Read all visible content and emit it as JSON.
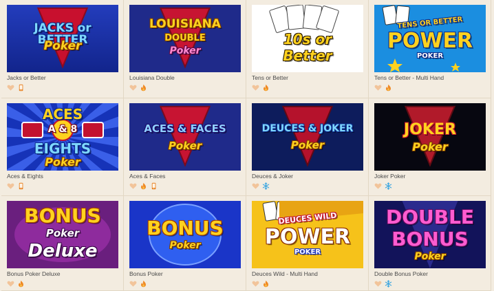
{
  "games": [
    {
      "title": "Jacks or Better",
      "logo_lines": [
        "JACKS or BETTER",
        "Poker"
      ],
      "theme": "blue-v",
      "icons": [
        "heart-icon",
        "mobile-icon"
      ]
    },
    {
      "title": "Louisiana Double",
      "logo_lines": [
        "LOUISIANA",
        "DOUBLE",
        "Poker"
      ],
      "theme": "navy-v",
      "icons": [
        "heart-icon",
        "fire-icon"
      ]
    },
    {
      "title": "Tens or Better",
      "logo_lines": [
        "10s or",
        "Better"
      ],
      "theme": "white-cards",
      "icons": [
        "heart-icon",
        "fire-icon"
      ]
    },
    {
      "title": "Tens or Better - Multi Hand",
      "logo_lines": [
        "TENS OR BETTER",
        "POWER",
        "POKER"
      ],
      "theme": "power-blue",
      "icons": [
        "heart-icon",
        "fire-icon"
      ]
    },
    {
      "title": "Aces & Eights",
      "logo_lines": [
        "ACES",
        "A & 8",
        "EIGHTS",
        "Poker"
      ],
      "theme": "rays-blue",
      "icons": [
        "heart-icon",
        "mobile-icon"
      ]
    },
    {
      "title": "Aces & Faces",
      "logo_lines": [
        "ACES & FACES",
        "Poker"
      ],
      "theme": "navy-v",
      "icons": [
        "heart-icon",
        "fire-icon",
        "mobile-icon"
      ]
    },
    {
      "title": "Deuces & Joker",
      "logo_lines": [
        "DEUCES & JOKER",
        "Poker"
      ],
      "theme": "dark-blue-v",
      "icons": [
        "heart-icon",
        "snowflake-icon"
      ]
    },
    {
      "title": "Joker Poker",
      "logo_lines": [
        "JOKER",
        "Poker"
      ],
      "theme": "black-v",
      "icons": [
        "heart-icon",
        "snowflake-icon"
      ]
    },
    {
      "title": "Bonus Poker Deluxe",
      "logo_lines": [
        "BONUS",
        "Poker",
        "Deluxe"
      ],
      "theme": "purple-deluxe",
      "icons": [
        "heart-icon",
        "fire-icon"
      ]
    },
    {
      "title": "Bonus Poker",
      "logo_lines": [
        "BONUS",
        "Poker"
      ],
      "theme": "blue-bonus",
      "icons": [
        "heart-icon",
        "fire-icon"
      ]
    },
    {
      "title": "Deuces Wild - Multi Hand",
      "logo_lines": [
        "DEUCES WILD",
        "POWER",
        "POKER"
      ],
      "theme": "yellow-power",
      "icons": [
        "heart-icon",
        "fire-icon"
      ]
    },
    {
      "title": "Double Bonus Poker",
      "logo_lines": [
        "DOUBLE",
        "BONUS",
        "Poker"
      ],
      "theme": "magenta-double",
      "icons": [
        "heart-icon",
        "snowflake-icon"
      ]
    }
  ],
  "colors": {
    "heart": "#f2c49a",
    "fire": "#f08a24",
    "snowflake": "#3ea7e0",
    "mobile": "#e8862a"
  }
}
